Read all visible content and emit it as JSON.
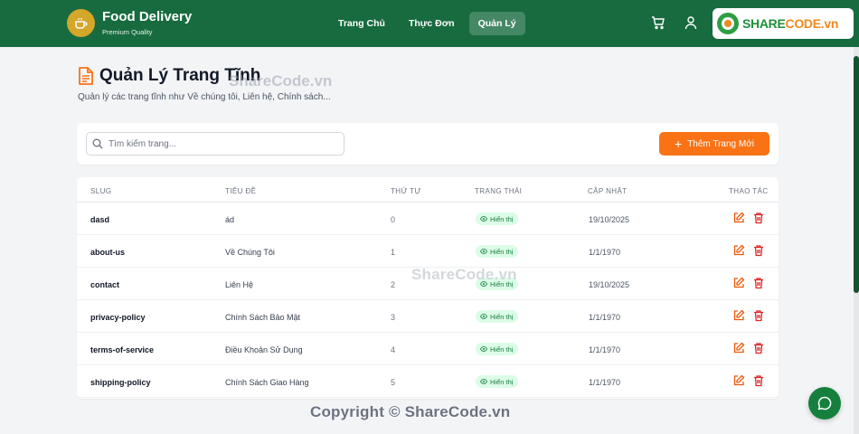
{
  "brand": {
    "name": "Food Delivery",
    "tagline": "Premium Quality"
  },
  "nav": [
    {
      "label": "Trang Chủ",
      "active": false
    },
    {
      "label": "Thực Đơn",
      "active": false
    },
    {
      "label": "Quản Lý",
      "active": true
    }
  ],
  "header_icons": [
    "cart-icon",
    "user-icon"
  ],
  "watermark_logo": {
    "prefix": "SHARE",
    "suffix": "CODE.vn"
  },
  "page": {
    "title": "Quản Lý Trang Tĩnh",
    "subtitle": "Quản lý các trang tĩnh như Về chúng tôi, Liên hệ, Chính sách..."
  },
  "search": {
    "placeholder": "Tìm kiếm trang..."
  },
  "add_button": {
    "label": "Thêm Trang Mới"
  },
  "table": {
    "columns": [
      "SLUG",
      "TIÊU ĐỀ",
      "THỨ TỰ",
      "TRẠNG THÁI",
      "CẬP NHẬT",
      "THAO TÁC"
    ],
    "rows": [
      {
        "slug": "dasd",
        "title": "ád",
        "order": "0",
        "status": "Hiển thị",
        "updated": "19/10/2025"
      },
      {
        "slug": "about-us",
        "title": "Về Chúng Tôi",
        "order": "1",
        "status": "Hiển thị",
        "updated": "1/1/1970"
      },
      {
        "slug": "contact",
        "title": "Liên Hệ",
        "order": "2",
        "status": "Hiển thị",
        "updated": "19/10/2025"
      },
      {
        "slug": "privacy-policy",
        "title": "Chính Sách Bảo Mật",
        "order": "3",
        "status": "Hiển thị",
        "updated": "1/1/1970"
      },
      {
        "slug": "terms-of-service",
        "title": "Điều Khoản Sử Dụng",
        "order": "4",
        "status": "Hiển thị",
        "updated": "1/1/1970"
      },
      {
        "slug": "shipping-policy",
        "title": "Chính Sách Giao Hàng",
        "order": "5",
        "status": "Hiển thị",
        "updated": "1/1/1970"
      }
    ]
  },
  "watermarks": {
    "center": "ShareCode.vn",
    "title_overlay": "ShareCode.vn",
    "bottom": "Copyright © ShareCode.vn"
  },
  "colors": {
    "header_bg": "#176b3f",
    "accent": "#f97316",
    "status_bg": "#dcfce7",
    "status_text": "#15803d",
    "action": "#dc2626"
  }
}
